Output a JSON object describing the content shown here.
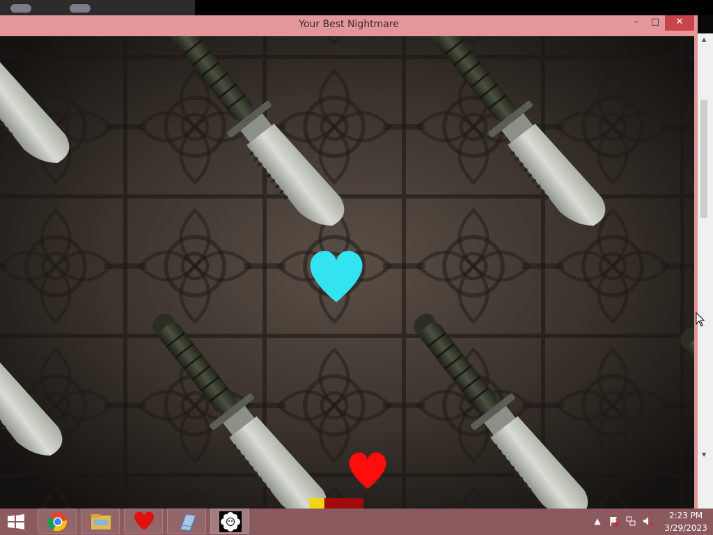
{
  "window": {
    "title": "Your Best Nightmare",
    "minimize_label": "–",
    "maximize_label": "□",
    "close_label": "✕"
  },
  "game": {
    "player_soul_color": "#ff0d0d",
    "enemy_soul_color": "#33e4f0",
    "hp_bar_fraction": 0.28,
    "hp_fill_color": "#f2d51a",
    "hp_empty_color": "#a00b0b"
  },
  "taskbar": {
    "apps": [
      {
        "name": "chrome-icon"
      },
      {
        "name": "file-explorer-icon"
      },
      {
        "name": "heart-game-icon"
      },
      {
        "name": "notebook-icon"
      },
      {
        "name": "flowey-icon"
      }
    ],
    "tray_icons": [
      "show-hidden-icons",
      "action-center-icon",
      "network-icon",
      "volume-muted-icon"
    ],
    "clock_time": "2:23 PM",
    "clock_date": "3/29/2023"
  }
}
